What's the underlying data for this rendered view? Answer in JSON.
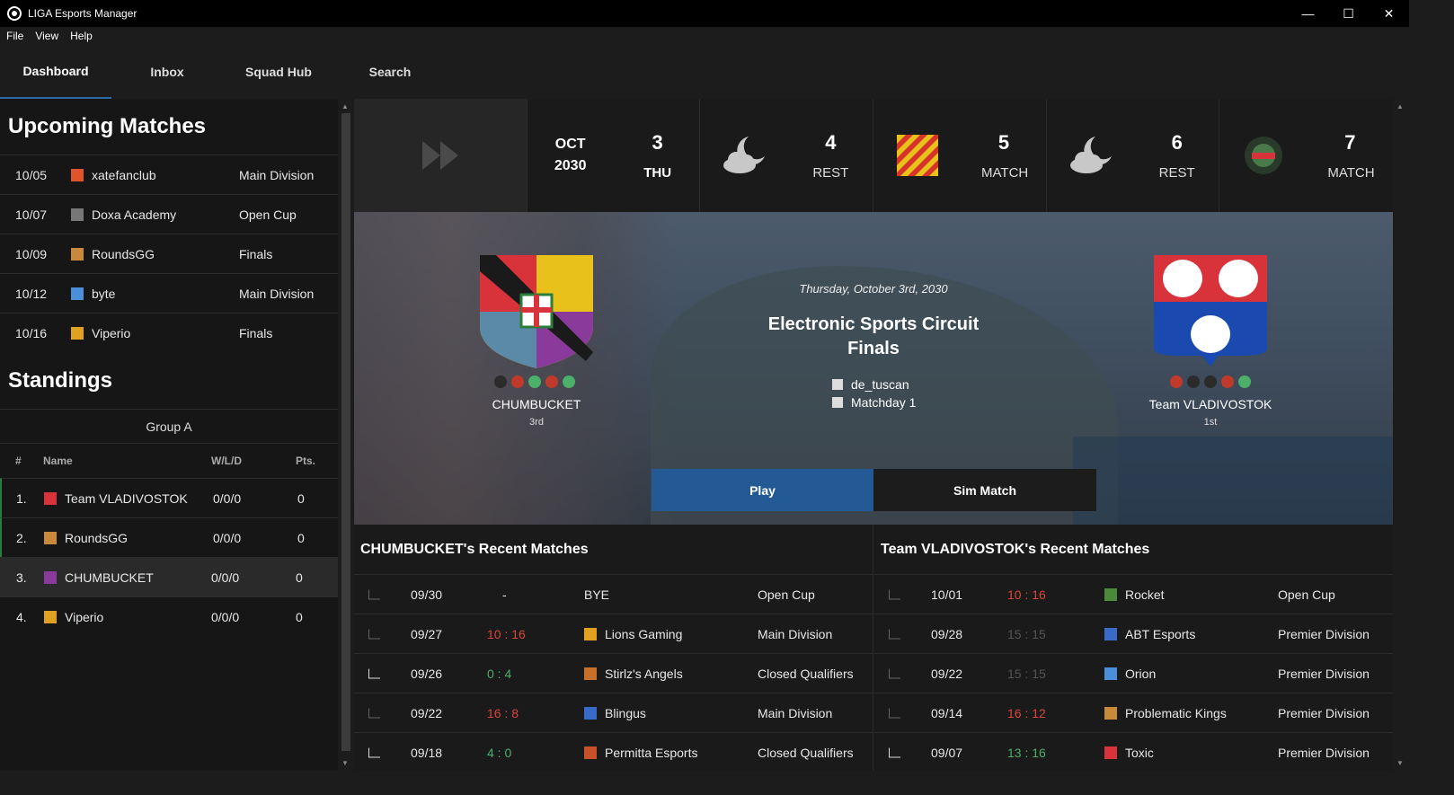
{
  "window": {
    "title": "LIGA Esports Manager",
    "min": "—",
    "max": "☐",
    "close": "✕"
  },
  "menu": [
    "File",
    "View",
    "Help"
  ],
  "tabs": [
    "Dashboard",
    "Inbox",
    "Squad Hub",
    "Search"
  ],
  "upcoming": {
    "title": "Upcoming Matches",
    "rows": [
      {
        "date": "10/05",
        "team": "xatefanclub",
        "comp": "Main Division",
        "flag": "#e0542c"
      },
      {
        "date": "10/07",
        "team": "Doxa Academy",
        "comp": "Open Cup",
        "flag": "#777777"
      },
      {
        "date": "10/09",
        "team": "RoundsGG",
        "comp": "Finals",
        "flag": "#c88a3a"
      },
      {
        "date": "10/12",
        "team": "byte",
        "comp": "Main Division",
        "flag": "#4a8fd8"
      },
      {
        "date": "10/16",
        "team": "Viperio",
        "comp": "Finals",
        "flag": "#e0a020"
      }
    ]
  },
  "standings": {
    "title": "Standings",
    "group": "Group A",
    "headers": {
      "num": "#",
      "name": "Name",
      "wld": "W/L/D",
      "pts": "Pts."
    },
    "rows": [
      {
        "rank": "1.",
        "team": "Team VLADIVOSTOK",
        "wld": "0/0/0",
        "pts": "0",
        "flag": "#d8333a"
      },
      {
        "rank": "2.",
        "team": "RoundsGG",
        "wld": "0/0/0",
        "pts": "0",
        "flag": "#c88a3a"
      },
      {
        "rank": "3.",
        "team": "CHUMBUCKET",
        "wld": "0/0/0",
        "pts": "0",
        "flag": "#8a3a9a"
      },
      {
        "rank": "4.",
        "team": "Viperio",
        "wld": "0/0/0",
        "pts": "0",
        "flag": "#e0a020"
      }
    ]
  },
  "calendar": {
    "month": "OCT",
    "year": "2030",
    "cells": [
      {
        "day": "3",
        "label": "THU"
      },
      {
        "day": "4",
        "label": "REST"
      },
      {
        "day": "5",
        "label": "MATCH"
      },
      {
        "day": "6",
        "label": "REST"
      },
      {
        "day": "7",
        "label": "MATCH"
      }
    ]
  },
  "match": {
    "date": "Thursday, October 3rd, 2030",
    "title": "Electronic Sports Circuit Finals",
    "map": "de_tuscan",
    "matchday": "Matchday 1",
    "home": {
      "name": "CHUMBUCKET",
      "pos": "3rd",
      "form": [
        "#2b2b2b",
        "#c0392b",
        "#4caf6a",
        "#c0392b",
        "#4caf6a"
      ]
    },
    "away": {
      "name": "Team VLADIVOSTOK",
      "pos": "1st",
      "form": [
        "#c0392b",
        "#2b2b2b",
        "#2b2b2b",
        "#c0392b",
        "#4caf6a"
      ]
    },
    "play": "Play",
    "sim": "Sim Match"
  },
  "recent_home": {
    "title": "CHUMBUCKET's Recent Matches",
    "rows": [
      {
        "date": "09/30",
        "score": "-",
        "res": "none",
        "team": "BYE",
        "comp": "Open Cup",
        "flag": ""
      },
      {
        "date": "09/27",
        "score": "10 : 16",
        "res": "loss",
        "team": "Lions Gaming",
        "comp": "Main Division",
        "flag": "#e0a020"
      },
      {
        "date": "09/26",
        "score": "0 : 4",
        "res": "win",
        "team": "Stirlz's Angels",
        "comp": "Closed Qualifiers",
        "flag": "#c8702a"
      },
      {
        "date": "09/22",
        "score": "16 : 8",
        "res": "loss",
        "team": "Blingus",
        "comp": "Main Division",
        "flag": "#3a6ac8"
      },
      {
        "date": "09/18",
        "score": "4 : 0",
        "res": "win",
        "team": "Permitta Esports",
        "comp": "Closed Qualifiers",
        "flag": "#c8502a"
      }
    ]
  },
  "recent_away": {
    "title": "Team VLADIVOSTOK's Recent Matches",
    "rows": [
      {
        "date": "10/01",
        "score": "10 : 16",
        "res": "loss",
        "team": "Rocket",
        "comp": "Open Cup",
        "flag": "#4a8a3a"
      },
      {
        "date": "09/28",
        "score": "15 : 15",
        "res": "draw",
        "team": "ABT Esports",
        "comp": "Premier Division",
        "flag": "#3a6ac8"
      },
      {
        "date": "09/22",
        "score": "15 : 15",
        "res": "draw",
        "team": "Orion",
        "comp": "Premier Division",
        "flag": "#4a8fd8"
      },
      {
        "date": "09/14",
        "score": "16 : 12",
        "res": "loss",
        "team": "Problematic Kings",
        "comp": "Premier Division",
        "flag": "#c88a3a"
      },
      {
        "date": "09/07",
        "score": "13 : 16",
        "res": "win",
        "team": "Toxic",
        "comp": "Premier Division",
        "flag": "#d8333a"
      }
    ]
  }
}
